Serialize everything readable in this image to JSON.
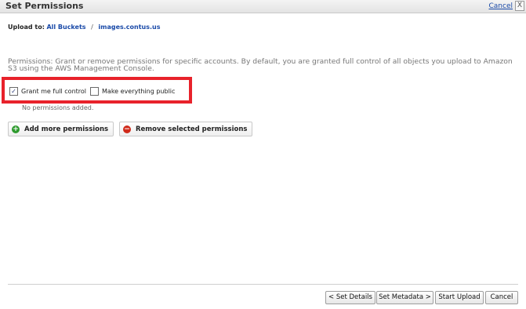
{
  "dialog": {
    "title": "Set Permissions",
    "cancel_link": "Cancel",
    "close_glyph": "X"
  },
  "upload_to": {
    "label": "Upload to:",
    "crumbs": [
      "All Buckets",
      "images.contus.us"
    ],
    "separator": "/"
  },
  "description": "Permissions: Grant or remove permissions for specific accounts. By default, you are granted full control of all objects you upload to Amazon S3 using the AWS Management Console.",
  "empty_state": "No permissions added.",
  "checkboxes": [
    {
      "label": "Grant me full control",
      "checked": true,
      "mark": "✓"
    },
    {
      "label": "Make everything public",
      "checked": false,
      "mark": ""
    }
  ],
  "actions": {
    "add": {
      "label": "Add more permissions",
      "icon": "plus-icon",
      "glyph": "+"
    },
    "remove": {
      "label": "Remove selected permissions",
      "icon": "minus-icon",
      "glyph": "−"
    }
  },
  "footer": {
    "set_details": "< Set Details",
    "set_metadata": "Set Metadata >",
    "start_upload": "Start Upload",
    "cancel": "Cancel"
  },
  "colors": {
    "highlight": "#e8222b",
    "link": "#1a4aa8",
    "add_icon": "#2e9a2e",
    "remove_icon": "#d02a1a"
  }
}
